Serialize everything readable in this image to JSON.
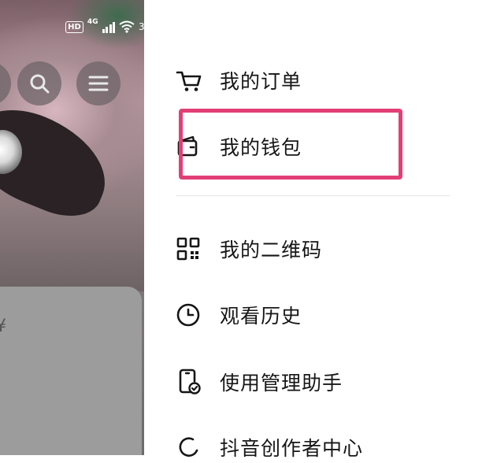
{
  "status_bar": {
    "hd": "HD",
    "network": "4G",
    "battery_partial": "3"
  },
  "profile_background": {
    "card_glyph": "¥"
  },
  "drawer": {
    "items": [
      {
        "label": "我的订单",
        "icon": "cart-icon"
      },
      {
        "label": "我的钱包",
        "icon": "wallet-icon"
      },
      {
        "label": "我的二维码",
        "icon": "qr-code-icon"
      },
      {
        "label": "观看历史",
        "icon": "clock-icon"
      },
      {
        "label": "使用管理助手",
        "icon": "phone-check-icon"
      },
      {
        "label": "抖音创作者中心",
        "icon": "creator-icon"
      }
    ],
    "highlighted_item": "我的钱包",
    "highlight_color": "#e23f77"
  }
}
